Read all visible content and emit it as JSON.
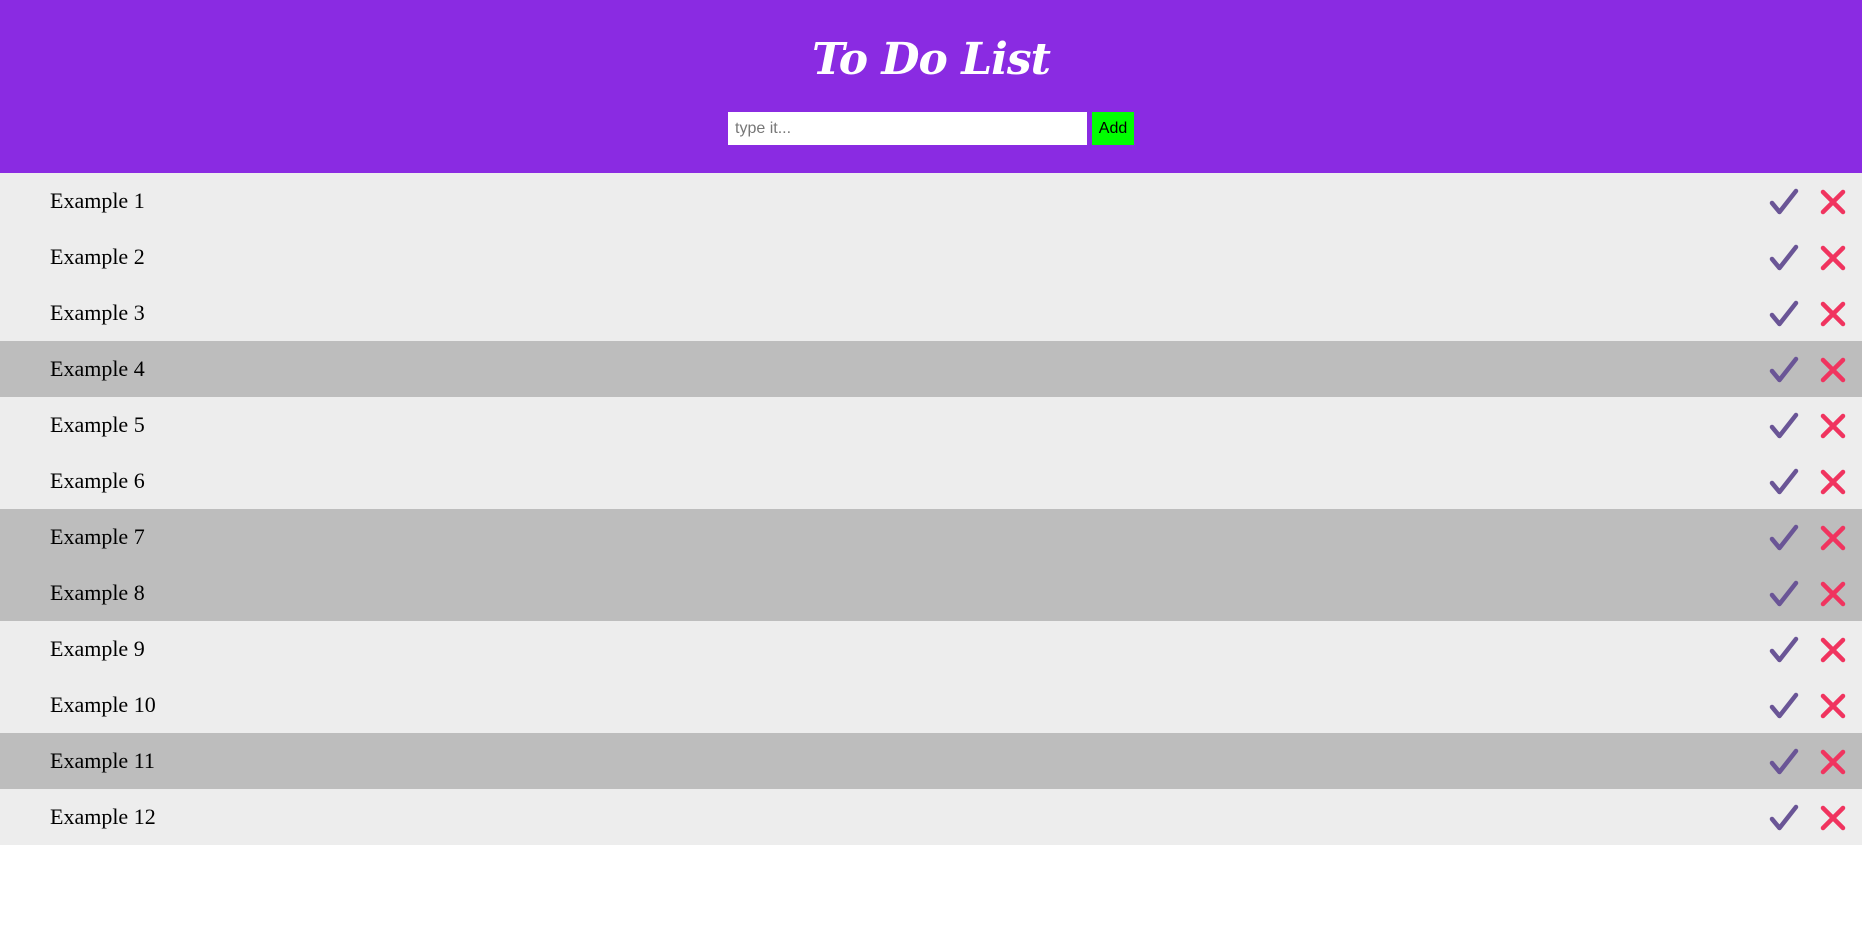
{
  "header": {
    "title": "To Do List",
    "background_color": "#8a2be2"
  },
  "form": {
    "input_placeholder": "type it...",
    "input_value": "",
    "add_label": "Add",
    "add_color": "#00ff00"
  },
  "colors": {
    "row_default": "#ededed",
    "row_done": "#bdbdbd",
    "check_icon": "#6a5596",
    "delete_icon": "#f0345f"
  },
  "icons": {
    "check": "check-icon",
    "delete": "close-icon"
  },
  "tasks": [
    {
      "text": "Example 1",
      "done": false
    },
    {
      "text": "Example 2",
      "done": false
    },
    {
      "text": "Example 3",
      "done": false
    },
    {
      "text": "Example 4",
      "done": true
    },
    {
      "text": "Example 5",
      "done": false
    },
    {
      "text": "Example 6",
      "done": false
    },
    {
      "text": "Example 7",
      "done": true
    },
    {
      "text": "Example 8",
      "done": true
    },
    {
      "text": "Example 9",
      "done": false
    },
    {
      "text": "Example 10",
      "done": false
    },
    {
      "text": "Example 11",
      "done": true
    },
    {
      "text": "Example 12",
      "done": false
    }
  ]
}
